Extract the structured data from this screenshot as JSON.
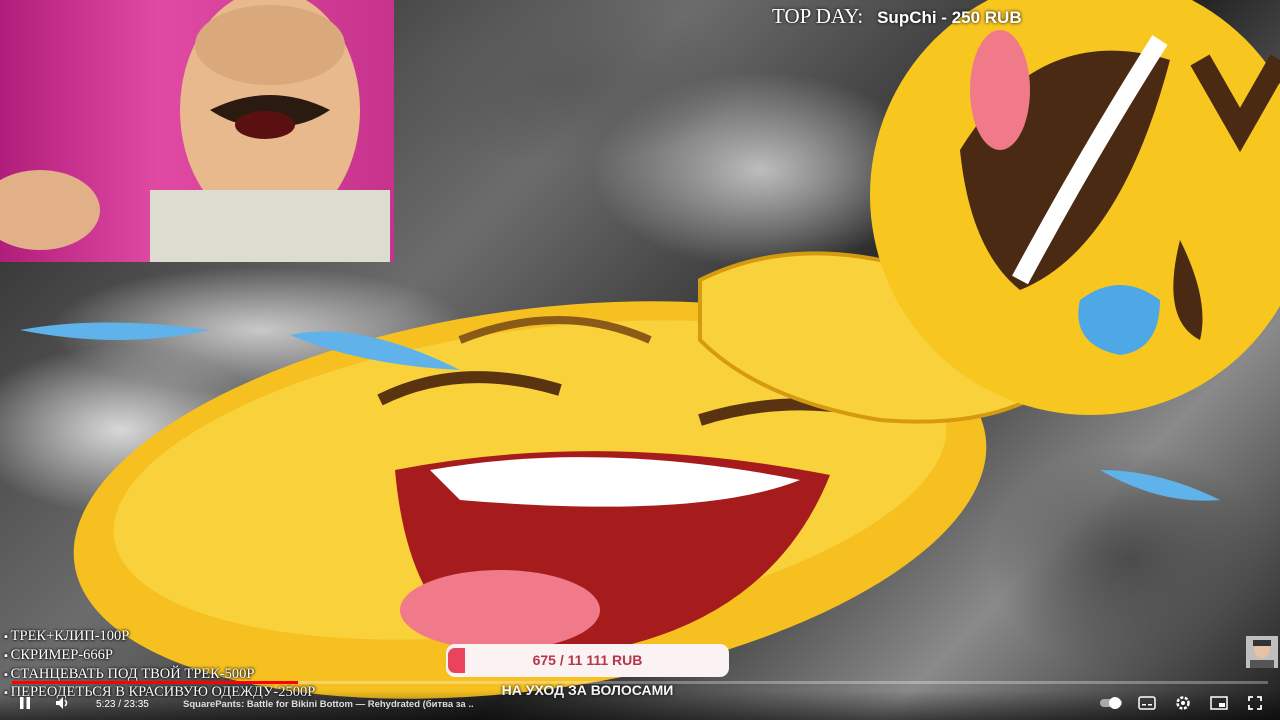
{
  "overlay": {
    "top_day_label": "TOP DAY:",
    "top_day_value": "SupChi - 250 RUB",
    "price_list": [
      "ТРЕК+КЛИП-100Р",
      "СКРИМЕР-666Р",
      "СТАНЦЕВАТЬ ПОД ТВОЙ ТРЕК-500Р",
      "ПЕРЕОДЕТЬСЯ В КРАСИВУЮ ОДЕЖДУ-2500Р"
    ],
    "goal": {
      "text": "675 / 11 111 RUB",
      "caption": "НА УХОД ЗА ВОЛОСАМИ",
      "progress_fraction": 0.061
    }
  },
  "player": {
    "current_time": "5:23",
    "duration": "23:35",
    "time_display": "5:23 / 23:35",
    "title": "SquarePants: Battle for Bikini Bottom — Rehydrated (битва за ...",
    "progress_fraction": 0.228,
    "icons": {
      "play_pause": "pause-icon",
      "volume": "volume-icon",
      "autoplay": "autoplay-toggle-icon",
      "subtitles": "subtitles-icon",
      "settings": "gear-icon",
      "miniplayer": "miniplayer-icon",
      "fullscreen": "fullscreen-icon"
    }
  },
  "colors": {
    "goal_fill": "#e9445c",
    "goal_text": "#b5354a",
    "progress": "#ff0000",
    "webcam_bg": "#c7338c",
    "emoji_yellow": "#f7c61f"
  }
}
